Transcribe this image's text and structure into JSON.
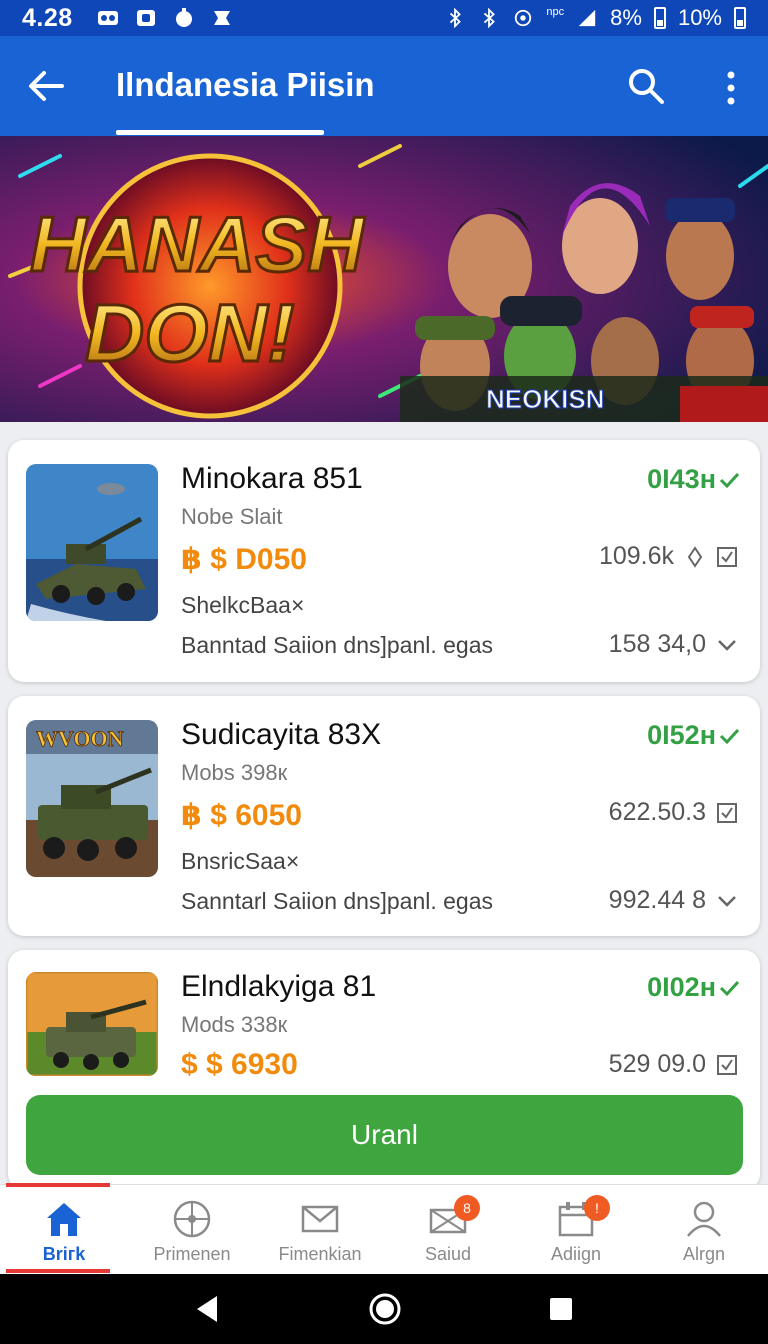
{
  "status_bar": {
    "time": "4.28",
    "signal_label": "npc",
    "battery_level": "8%",
    "battery_pct": "10%"
  },
  "app_bar": {
    "title": "Ilndanesia Piisin"
  },
  "banner": {
    "headline_line1": "HANASH",
    "headline_line2": "DON!",
    "brand": "NEOKISN"
  },
  "cards": [
    {
      "name": "Minokara 851",
      "sub": "Nobe Slait",
      "price": "฿ $ D050",
      "tag": "ShelkcBaa×",
      "desc": "Banntad Saiion dns]panl. egas",
      "time": "0I43н",
      "stat1": "109.6k",
      "stat2": "158 34,0"
    },
    {
      "name": "Sudicayita 83X",
      "sub": "Mobs 398к",
      "price": "฿ $ 6050",
      "tag": "BnsricSaa×",
      "desc": "Sanntarl Saiion dns]panl. egas",
      "time": "0I52н",
      "stat1": "622.50.3",
      "stat2": "992.44 8",
      "thumb_label": "WVOON"
    },
    {
      "name": "Elndlakyiga 81",
      "sub": "Mods 338к",
      "price": "$ $ 6930",
      "time": "0I02н",
      "stat1": "529 09.0"
    }
  ],
  "action_button": {
    "label": "Uranl"
  },
  "bottom_nav": [
    {
      "label": "Briгk",
      "icon": "home-icon",
      "active": true
    },
    {
      "label": "Primenen",
      "icon": "compass-icon"
    },
    {
      "label": "Fimenkian",
      "icon": "envelope-icon"
    },
    {
      "label": "Saiud",
      "icon": "mail-icon",
      "badge": "8"
    },
    {
      "label": "Adiign",
      "icon": "calendar-icon",
      "badge": "!"
    },
    {
      "label": "Alrgn",
      "icon": "person-icon"
    }
  ],
  "colors": {
    "primary": "#1a63d4",
    "status_bar": "#0f47b8",
    "accent_green": "#3ea53f",
    "price_orange": "#f28a0c",
    "time_green": "#33a143"
  }
}
